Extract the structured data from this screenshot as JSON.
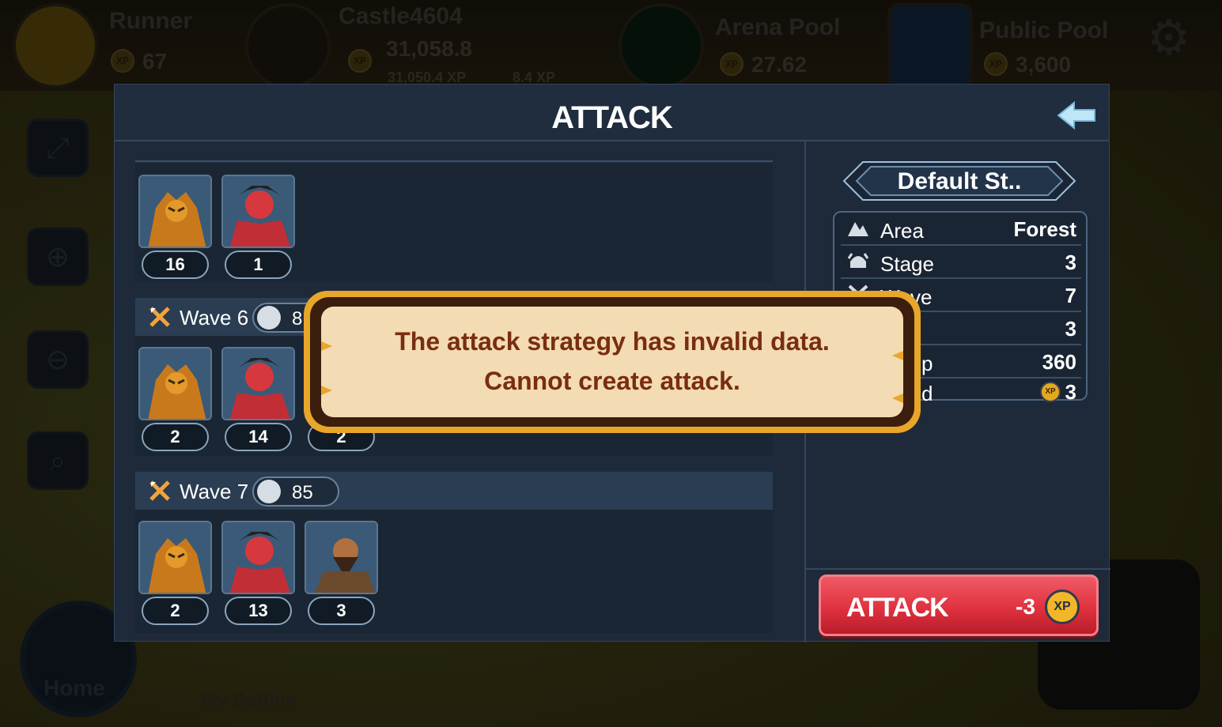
{
  "top_bar": {
    "player": {
      "name": "Runner",
      "xp": "67"
    },
    "castle": {
      "name": "Castle4604",
      "value": "31,058.8",
      "sub_xp": "31,050.4 XP",
      "sub_gain": "8.4 XP"
    },
    "arena_pool": {
      "name": "Arena Pool",
      "value": "27.62"
    },
    "public_pool": {
      "name": "Public Pool",
      "value": "3,600"
    }
  },
  "nav": {
    "home_label": "Home",
    "battles_label": "My Battles"
  },
  "modal": {
    "title": "ATTACK",
    "waves": [
      {
        "name": "",
        "power": "",
        "units": [
          {
            "kind": "dragon",
            "count": "16"
          },
          {
            "kind": "demon",
            "count": "1"
          }
        ]
      },
      {
        "name": "Wave 6",
        "power": "8",
        "units": [
          {
            "kind": "dragon",
            "count": "2"
          },
          {
            "kind": "demon",
            "count": "14"
          },
          {
            "kind": "barbarian",
            "count": "2"
          }
        ]
      },
      {
        "name": "Wave 7",
        "power": "85",
        "units": [
          {
            "kind": "dragon",
            "count": "2"
          },
          {
            "kind": "demon",
            "count": "13"
          },
          {
            "kind": "barbarian",
            "count": "3"
          }
        ]
      }
    ],
    "strategy": {
      "label": "Default St.."
    },
    "info": {
      "area": {
        "label": "Area",
        "value": "Forest"
      },
      "stage": {
        "label": "Stage",
        "value": "3"
      },
      "wave": {
        "label": "Wave",
        "value": "7"
      },
      "row4": {
        "value": "3"
      },
      "row5": {
        "label_tail": "p",
        "value": "360"
      },
      "row6": {
        "label_tail": "d",
        "value": "3"
      }
    },
    "attack_button": {
      "label": "ATTACK",
      "cost": "-3",
      "currency": "XP"
    }
  },
  "error": {
    "line1": "The attack strategy has invalid data.",
    "line2": "Cannot create attack."
  },
  "colors": {
    "modal_bg": "#1e2a3a",
    "attack_red": "#e0323f",
    "popup_gold": "#e8a62a",
    "popup_text": "#7a2d10"
  }
}
